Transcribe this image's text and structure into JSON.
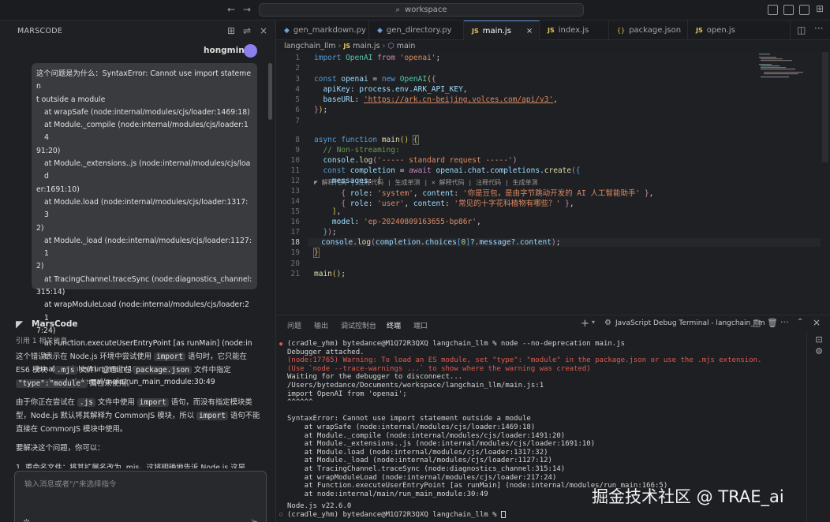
{
  "titlebar": {
    "search": "workspace"
  },
  "left_panel": {
    "title": "MARSCODE",
    "user": {
      "name": "hongming"
    },
    "user_message_lines": [
      "这个问题是为什么：SyntaxError: Cannot use import statemen",
      "t outside a module",
      "at wrapSafe (node:internal/modules/cjs/loader:1469:18)",
      "at Module._compile (node:internal/modules/cjs/loader:14",
      "91:20)",
      "at Module._extensions..js (node:internal/modules/cjs/load",
      "er:1691:10)",
      "at Module.load (node:internal/modules/cjs/loader:1317:3",
      "2)",
      "at Module._load (node:internal/modules/cjs/loader:1127:1",
      "2)",
      "at TracingChannel.traceSync (node:diagnostics_channel:",
      "315:14)",
      "at wrapModuleLoad (node:internal/modules/cjs/loader:21",
      "7:24)",
      "at Function.executeUserEntryPoint [as runMain] (node:int",
      "ernal/modules/run_main:166:5)",
      "at node:internal/main/run_main_module:30:49"
    ],
    "bot": {
      "name": "MarsCode",
      "ref": "引用 1 相关信息",
      "p1_a": "这个错误表示在 Node.js 环境中尝试使用",
      "p1_code1": "import",
      "p1_b": "语句时，它只能在 ES6 模块（",
      "p1_code2": ".mjs",
      "p1_c": "文件）或通过在",
      "p1_code3": "package.json",
      "p1_d": "文件中指定",
      "p1_code4": "\"type\":\"module\"",
      "p1_e": "属性来使用。",
      "p2_a": "由于你正在尝试在",
      "p2_code1": ".js",
      "p2_b": "文件中使用",
      "p2_code2": "import",
      "p2_c": "语句，而没有指定模块类型，Node.js 默认将其解释为 CommonJS 模块，所以",
      "p2_code3": "import",
      "p2_d": "语句不能直接在 CommonJS 模块中使用。",
      "p3": "要解决这个问题，你可以：",
      "p4": "1. 重命名文件：将其扩展名改为 .mjs，这将明确地告诉 Node.js 这是"
    },
    "input": {
      "placeholder": "输入消息或者\"/\"来选择指令"
    }
  },
  "tabs": [
    {
      "label": "gen_markdown.py",
      "icon": "python-icon",
      "active": false
    },
    {
      "label": "gen_directory.py",
      "icon": "python-icon",
      "active": false
    },
    {
      "label": "main.js",
      "icon": "js-icon",
      "active": true
    },
    {
      "label": "index.js",
      "icon": "js-icon",
      "active": false
    },
    {
      "label": "package.json",
      "icon": "json-icon",
      "active": false
    },
    {
      "label": "open.js",
      "icon": "js-icon",
      "active": false
    }
  ],
  "breadcrumb": {
    "a": "langchain_llm",
    "b": "main.js",
    "c": "main"
  },
  "codelens": "解释代码 | 注释代码 | 生成单测 | ×   解释代码 | 注释代码 | 生成单测",
  "code_line_numbers": [
    "1",
    "2",
    "3",
    "4",
    "5",
    "6",
    "7",
    "8",
    "9",
    "10",
    "11",
    "12",
    "13",
    "14",
    "15",
    "16",
    "17",
    "18",
    "19",
    "20",
    "21"
  ],
  "code": {
    "l1_kw": "import",
    "l1_cls": "OpenAI",
    "l1_from": "from",
    "l1_str": "'openai'",
    "l3_kw": "const",
    "l3_var": "openai",
    "l3_new": "new",
    "l3_cls": "OpenAI",
    "l4_key": "apiKey",
    "l4_val": "process.env.",
    "l4_env": "ARK_API_KEY",
    "l5_key": "baseURL",
    "l5_url": "'https://ark.cn-beijing.volces.com/api/v3'",
    "l8_kw": "async function",
    "l8_fn": "main",
    "l9_cm": "// Non-streaming:",
    "l10_a": "console.",
    "l10_fn": "log",
    "l10_str": "'----- standard request -----'",
    "l11_kw": "const",
    "l11_var": "completion",
    "l11_aw": "await",
    "l11_obj": "openai.chat.completions.",
    "l11_fn": "create",
    "l12_key": "messages",
    "l13_role": "role",
    "l13_r": "'system'",
    "l13_content": "content",
    "l13_c": "'你是豆包，是由字节跳动开发的 AI 人工智能助手'",
    "l14_role": "role",
    "l14_r": "'user'",
    "l14_content": "content",
    "l14_c": "'常见的十字花科植物有哪些？'",
    "l16_key": "model",
    "l16_val": "'ep-20240809163655-bp86r'",
    "l18_a": "console.",
    "l18_fn": "log",
    "l18_b": "completion.choices",
    "l18_idx": "0",
    "l18_c": "?.message?.content",
    "l21_fn": "main"
  },
  "terminal_tabs": [
    "问题",
    "输出",
    "调试控制台",
    "终端",
    "端口"
  ],
  "terminal_title": "JavaScript Debug Terminal - langchain_llm",
  "terminal_lines": [
    "(cradle_yhm) bytedance@M1Q72R3QXQ langchain_llm % node --no-deprecation main.js",
    "Debugger attached.",
    "(node:17765) Warning: To load an ES module, set \"type\": \"module\" in the package.json or use the .mjs extension.",
    "(Use `node --trace-warnings ...` to show where the warning was created)",
    "Waiting for the debugger to disconnect...",
    "/Users/bytedance/Documents/workspace/langchain_llm/main.js:1",
    "import OpenAI from 'openai';",
    "^^^^^^",
    "",
    "SyntaxError: Cannot use import statement outside a module",
    "    at wrapSafe (node:internal/modules/cjs/loader:1469:18)",
    "    at Module._compile (node:internal/modules/cjs/loader:1491:20)",
    "    at Module._extensions..js (node:internal/modules/cjs/loader:1691:10)",
    "    at Module.load (node:internal/modules/cjs/loader:1317:32)",
    "    at Module._load (node:internal/modules/cjs/loader:1127:12)",
    "    at TracingChannel.traceSync (node:diagnostics_channel:315:14)",
    "    at wrapModuleLoad (node:internal/modules/cjs/loader:217:24)",
    "    at Function.executeUserEntryPoint [as runMain] (node:internal/modules/run_main:166:5)",
    "    at node:internal/main/run_main_module:30:49",
    "",
    "Node.js v22.6.0",
    "(cradle_yhm) bytedance@M1Q72R3QXQ langchain_llm % "
  ],
  "watermark": "掘金技术社区 @ TRAE_ai"
}
